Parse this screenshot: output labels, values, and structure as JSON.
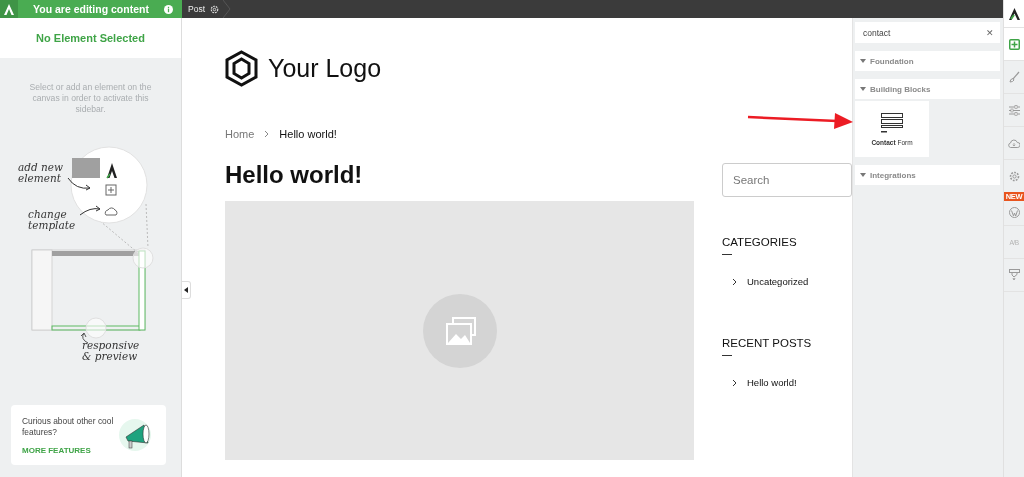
{
  "topbar": {
    "editing_label": "You are editing content",
    "breadcrumb": "Post"
  },
  "left_sidebar": {
    "title": "No Element Selected",
    "hint": "Select or add an element on the canvas in order to activate this sidebar.",
    "illustration_labels": [
      "add new element",
      "change template",
      "responsive & preview"
    ],
    "promo": {
      "text": "Curious about other cool features?",
      "link": "MORE FEATURES"
    }
  },
  "canvas": {
    "logo": "Your Logo",
    "breadcrumbs": [
      "Home",
      "Hello world!"
    ],
    "title": "Hello world!",
    "search_placeholder": "Search",
    "widgets": [
      {
        "heading": "CATEGORIES",
        "items": [
          "Uncategorized"
        ]
      },
      {
        "heading": "RECENT POSTS",
        "items": [
          "Hello world!"
        ]
      }
    ]
  },
  "elements_panel": {
    "search": "contact",
    "clear_symbol": "✕",
    "sections": [
      {
        "label": "Foundation"
      },
      {
        "label": "Building Blocks",
        "items": [
          {
            "label": "**Contact** Form"
          }
        ]
      },
      {
        "label": "Integrations"
      }
    ]
  },
  "rail": {
    "items": [
      {
        "kind": "logo",
        "selected": false
      },
      {
        "kind": "add",
        "selected": true
      },
      {
        "kind": "brush",
        "selected": false
      },
      {
        "kind": "sliders",
        "selected": false
      },
      {
        "kind": "cloud",
        "selected": false
      },
      {
        "kind": "gear",
        "selected": false
      },
      {
        "kind": "wordpress",
        "selected": false,
        "badge": "NEW"
      },
      {
        "kind": "ab",
        "selected": false,
        "label": "A/B"
      },
      {
        "kind": "stamp",
        "selected": false
      }
    ]
  }
}
